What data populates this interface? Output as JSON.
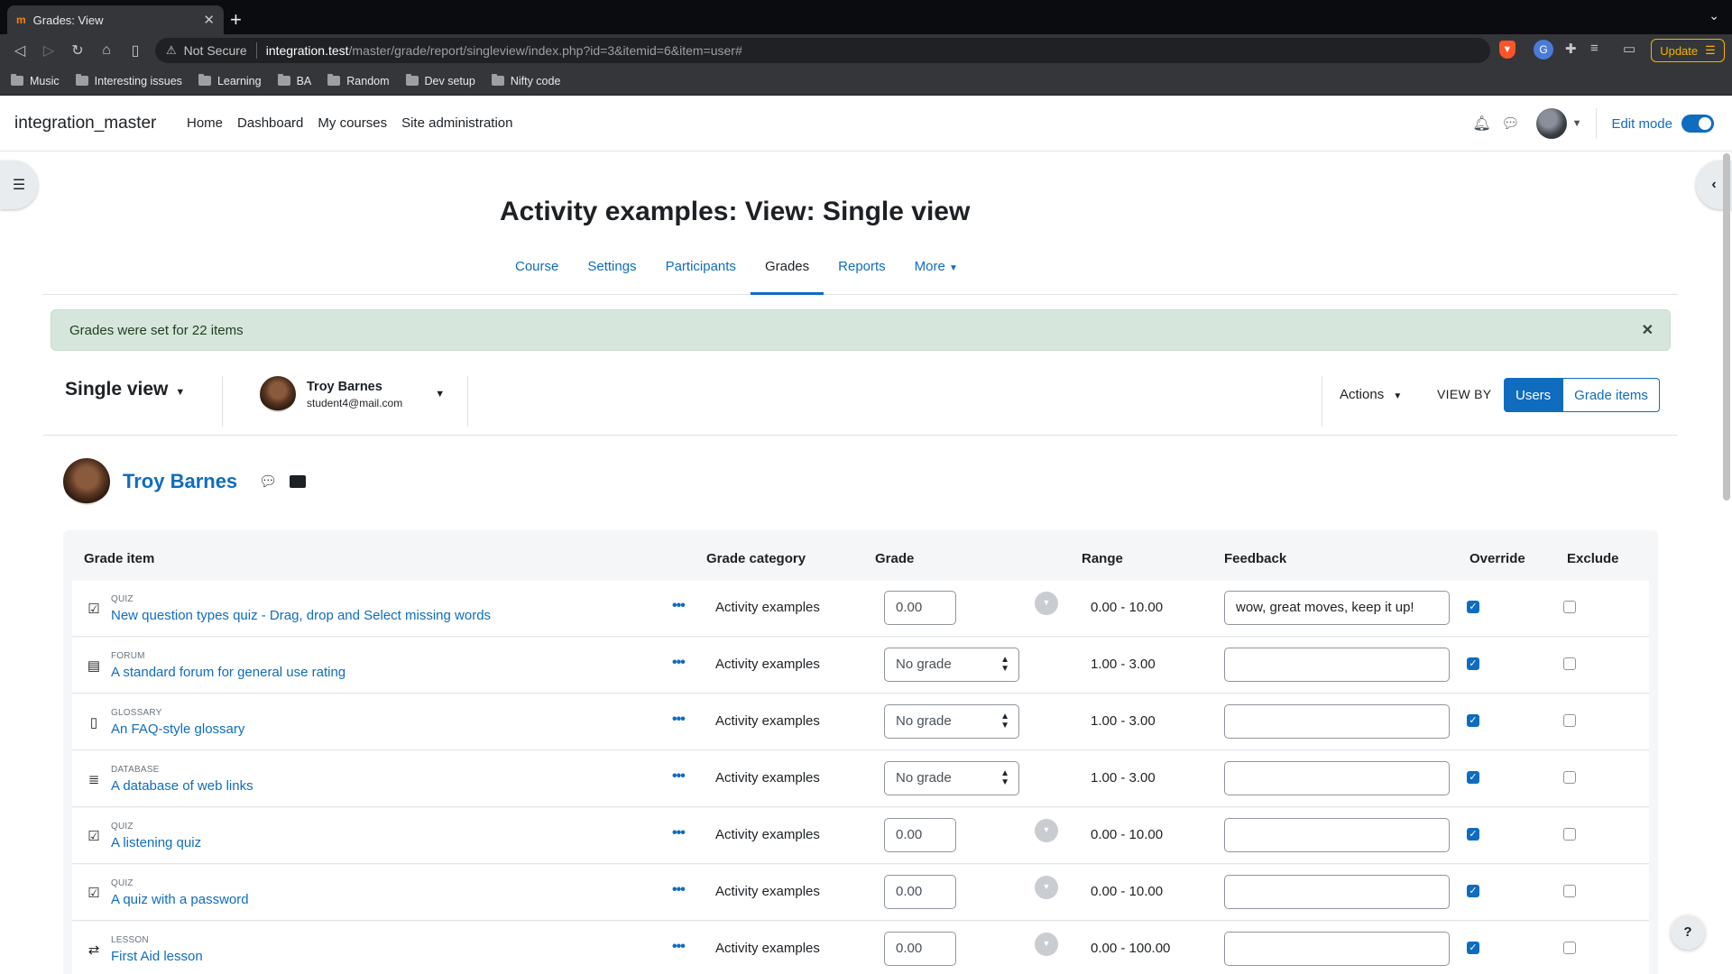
{
  "browser": {
    "tab_title": "Grades: View",
    "tab_favicon": "m",
    "security_label": "Not Secure",
    "url_host": "integration.test",
    "url_path": "/master/grade/report/singleview/index.php?id=3&itemid=6&item=user#",
    "update_label": "Update",
    "bookmarks": [
      "Music",
      "Interesting issues",
      "Learning",
      "BA",
      "Random",
      "Dev setup",
      "Nifty code"
    ]
  },
  "navbar": {
    "site_name": "integration_master",
    "links": [
      "Home",
      "Dashboard",
      "My courses",
      "Site administration"
    ],
    "edit_mode_label": "Edit mode"
  },
  "page": {
    "title": "Activity examples: View: Single view",
    "tabs": [
      "Course",
      "Settings",
      "Participants",
      "Grades",
      "Reports",
      "More"
    ],
    "active_tab": "Grades",
    "alert": "Grades were set for 22 items"
  },
  "tertiary": {
    "report_title": "Single view",
    "user_name": "Troy Barnes",
    "user_email": "student4@mail.com",
    "actions_label": "Actions",
    "view_by_label": "VIEW BY",
    "view_users": "Users",
    "view_grade_items": "Grade items"
  },
  "user_heading": {
    "name": "Troy Barnes"
  },
  "table": {
    "headers": {
      "grade_item": "Grade item",
      "category": "Grade category",
      "grade": "Grade",
      "range": "Range",
      "feedback": "Feedback",
      "override": "Override",
      "exclude": "Exclude"
    },
    "rows": [
      {
        "module": "QUIZ",
        "name": "New question types quiz - Drag, drop and Select missing words",
        "category": "Activity examples",
        "grade": "0.00",
        "range": "0.00 - 10.00",
        "feedback": "wow, great moves, keep it up!"
      },
      {
        "module": "FORUM",
        "name": "A standard forum for general use rating",
        "category": "Activity examples",
        "grade": "No grade",
        "range": "1.00 - 3.00",
        "feedback": ""
      },
      {
        "module": "GLOSSARY",
        "name": "An FAQ-style glossary",
        "category": "Activity examples",
        "grade": "No grade",
        "range": "1.00 - 3.00",
        "feedback": ""
      },
      {
        "module": "DATABASE",
        "name": "A database of web links",
        "category": "Activity examples",
        "grade": "No grade",
        "range": "1.00 - 3.00",
        "feedback": ""
      },
      {
        "module": "QUIZ",
        "name": "A listening quiz",
        "category": "Activity examples",
        "grade": "0.00",
        "range": "0.00 - 10.00",
        "feedback": ""
      },
      {
        "module": "QUIZ",
        "name": "A quiz with a password",
        "category": "Activity examples",
        "grade": "0.00",
        "range": "0.00 - 10.00",
        "feedback": ""
      },
      {
        "module": "LESSON",
        "name": "First Aid lesson",
        "category": "Activity examples",
        "grade": "0.00",
        "range": "0.00 - 100.00",
        "feedback": ""
      }
    ]
  },
  "colors": {
    "accent": "#0f6cbf",
    "alert_bg": "#d7e6dc"
  }
}
